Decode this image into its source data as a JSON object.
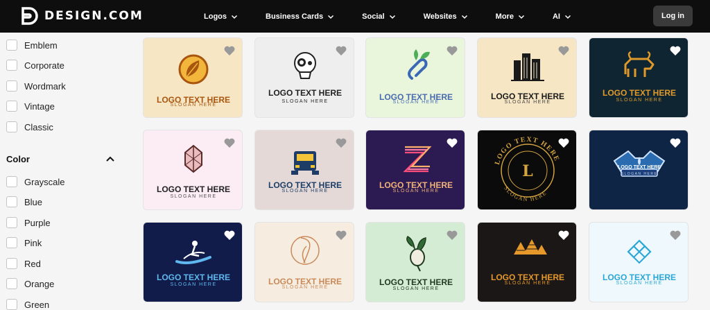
{
  "brand": {
    "name": "DESIGN.COM"
  },
  "nav": {
    "items": [
      {
        "label": "Logos"
      },
      {
        "label": "Business Cards"
      },
      {
        "label": "Social"
      },
      {
        "label": "Websites"
      },
      {
        "label": "More"
      },
      {
        "label": "AI"
      }
    ],
    "login_label": "Log in"
  },
  "sidebar": {
    "style_options": [
      {
        "label": "Emblem"
      },
      {
        "label": "Corporate"
      },
      {
        "label": "Wordmark"
      },
      {
        "label": "Vintage"
      },
      {
        "label": "Classic"
      }
    ],
    "color_section_title": "Color",
    "color_options": [
      {
        "label": "Grayscale"
      },
      {
        "label": "Blue"
      },
      {
        "label": "Purple"
      },
      {
        "label": "Pink"
      },
      {
        "label": "Red"
      },
      {
        "label": "Orange"
      },
      {
        "label": "Green"
      }
    ]
  },
  "cards": [
    {
      "bg": "#f7e6c4",
      "title": "LOGO TEXT HERE",
      "slogan": "SLOGAN HERE",
      "title_color": "#a8560f",
      "slogan_color": "#a8560f",
      "icon": "leaf-icon",
      "heart": "#999999"
    },
    {
      "bg": "#eeeeee",
      "title": "LOGO TEXT HERE",
      "slogan": "SLOGAN HERE",
      "title_color": "#222222",
      "slogan_color": "#222222",
      "icon": "skull-icon",
      "heart": "#999999"
    },
    {
      "bg": "#e9f6dc",
      "title": "LOGO TEXT HERE",
      "slogan": "SLOGAN HERE",
      "title_color": "#4a6ab0",
      "slogan_color": "#4a6ab0",
      "icon": "paperclip-leaf-icon",
      "heart": "#999999"
    },
    {
      "bg": "#f7e6c4",
      "title": "LOGO TEXT HERE",
      "slogan": "SLOGAN HERE",
      "title_color": "#1a1a1a",
      "slogan_color": "#444444",
      "icon": "buildings-icon",
      "heart": "#999999"
    },
    {
      "bg": "#0f2632",
      "title": "LOGO TEXT HERE",
      "slogan": "SLOGAN HERE",
      "title_color": "#e09a2c",
      "slogan_color": "#e09a2c",
      "icon": "bull-icon",
      "heart": "#ffffff"
    },
    {
      "bg": "#fcecf3",
      "title": "LOGO TEXT HERE",
      "slogan": "SLOGAN HERE",
      "title_color": "#222222",
      "slogan_color": "#555555",
      "icon": "gem-icon",
      "heart": "#999999"
    },
    {
      "bg": "#e4d9d6",
      "title": "LOGO TEXT HERE",
      "slogan": "SLOGAN HERE",
      "title_color": "#1d3d66",
      "slogan_color": "#1d3d66",
      "icon": "truck-icon",
      "heart": "#999999"
    },
    {
      "bg": "#2c1a52",
      "title": "LOGO TEXT HERE",
      "slogan": "SLOGAN HERE",
      "title_color": "#f2b37a",
      "slogan_color": "#f2b37a",
      "icon": "letter-z-icon",
      "heart": "#ffffff"
    },
    {
      "bg": "#0b0b0b",
      "title": "LOGO TEXT HERE",
      "slogan": "SLOGAN HERE",
      "title_color": "#d4a441",
      "slogan_color": "#d4a441",
      "icon": "letter-l-badge-icon",
      "badge_letter": "L",
      "heart": "#ffffff"
    },
    {
      "bg": "#0f2546",
      "title": "LOGO TEXT HERE",
      "slogan": "SLOGAN HERE",
      "title_color": "#ffffff",
      "slogan_color": "#c9d6ee",
      "icon": "wrench-badge-icon",
      "heart": "#ffffff"
    },
    {
      "bg": "#121c4a",
      "title": "LOGO TEXT HERE",
      "slogan": "SLOGAN HERE",
      "title_color": "#5fb8ef",
      "slogan_color": "#5fb8ef",
      "icon": "surfer-icon",
      "heart": "#ffffff"
    },
    {
      "bg": "#f6ece0",
      "title": "LOGO TEXT HERE",
      "slogan": "SLOGAN HERE",
      "title_color": "#c98a5a",
      "slogan_color": "#c98a5a",
      "icon": "woman-circle-icon",
      "heart": "#999999"
    },
    {
      "bg": "#d5ecd4",
      "title": "LOGO TEXT HERE",
      "slogan": "SLOGAN HERE",
      "title_color": "#1f3a1f",
      "slogan_color": "#1f3a1f",
      "icon": "radish-icon",
      "heart": "#999999"
    },
    {
      "bg": "#1b1716",
      "title": "LOGO TEXT HERE",
      "slogan": "SLOGAN HERE",
      "title_color": "#e6982a",
      "slogan_color": "#e6982a",
      "icon": "pyramids-icon",
      "heart": "#ffffff"
    },
    {
      "bg": "#eef8fd",
      "title": "LOGO TEXT HERE",
      "slogan": "SLOGAN HERE",
      "title_color": "#2aa6d6",
      "slogan_color": "#2aa6d6",
      "icon": "diamond-pattern-icon",
      "heart": "#999999"
    }
  ]
}
